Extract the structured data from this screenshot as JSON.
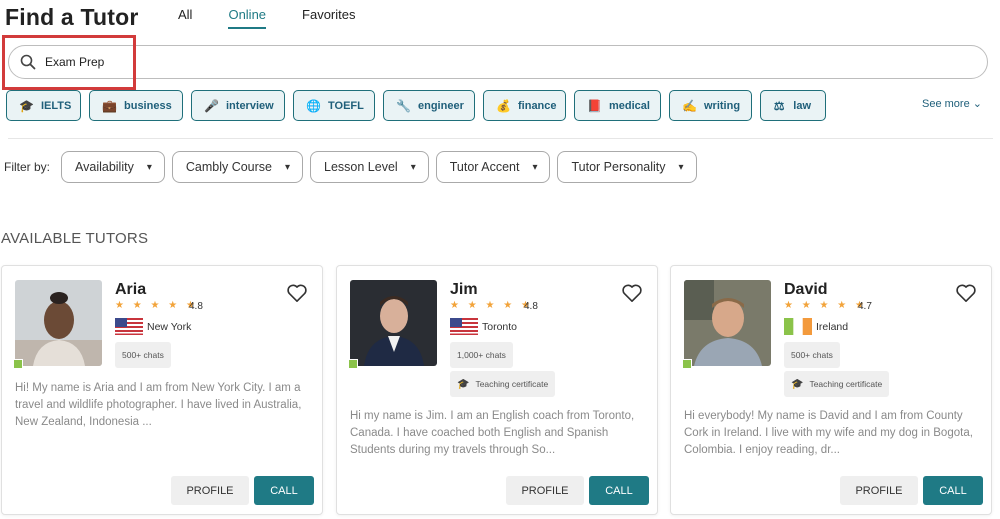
{
  "header": {
    "title": "Find a Tutor"
  },
  "tabs": [
    {
      "label": "All"
    },
    {
      "label": "Online",
      "active": true
    },
    {
      "label": "Favorites"
    }
  ],
  "search": {
    "value": "Exam Prep",
    "icon": "search-icon"
  },
  "chips": [
    {
      "label": "IELTS",
      "icon": "graduation-cap-icon"
    },
    {
      "label": "business",
      "icon": "briefcase-icon"
    },
    {
      "label": "interview",
      "icon": "microphone-icon"
    },
    {
      "label": "TOEFL",
      "icon": "globe-icon"
    },
    {
      "label": "engineer",
      "icon": "wrench-icon"
    },
    {
      "label": "finance",
      "icon": "money-bag-icon"
    },
    {
      "label": "medical",
      "icon": "medical-book-icon"
    },
    {
      "label": "writing",
      "icon": "writing-hand-icon"
    },
    {
      "label": "law",
      "icon": "scales-icon"
    }
  ],
  "see_more": "See more",
  "filters": {
    "label": "Filter by:",
    "items": [
      {
        "label": "Availability"
      },
      {
        "label": "Cambly Course"
      },
      {
        "label": "Lesson Level"
      },
      {
        "label": "Tutor Accent"
      },
      {
        "label": "Tutor Personality"
      }
    ]
  },
  "section_title": "AVAILABLE TUTORS",
  "tutors": [
    {
      "name": "Aria",
      "stars": "★ ★ ★ ★ ★",
      "rating": "4.8",
      "location": "New York",
      "flag": "us",
      "chats": "500+ chats",
      "certificate": "",
      "bio": "Hi! My name is Aria and I am from New York City. I am a travel and wildlife photographer. I have lived in Australia, New Zealand, Indonesia ...",
      "profile_label": "PROFILE",
      "call_label": "CALL"
    },
    {
      "name": "Jim",
      "stars": "★ ★ ★ ★ ★",
      "rating": "4.8",
      "location": "Toronto",
      "flag": "us",
      "chats": "1,000+ chats",
      "certificate": "Teaching certificate",
      "bio": "Hi my name is Jim. I am an English coach from Toronto, Canada. I have coached both English and Spanish Students during my travels through So...",
      "profile_label": "PROFILE",
      "call_label": "CALL"
    },
    {
      "name": "David",
      "stars": "★ ★ ★ ★ ★",
      "rating": "4.7",
      "location": "Ireland",
      "flag": "ie",
      "chats": "500+ chats",
      "certificate": "Teaching certificate",
      "bio": "Hi everybody! My name is David and I am from County Cork in Ireland. I live with my wife and my dog in Bogota, Colombia. I enjoy reading, dr...",
      "profile_label": "PROFILE",
      "call_label": "CALL"
    }
  ],
  "colors": {
    "accent": "#1f7a85",
    "highlight": "#d23b3b",
    "online": "#8bc34a",
    "star": "#f2a33a"
  }
}
